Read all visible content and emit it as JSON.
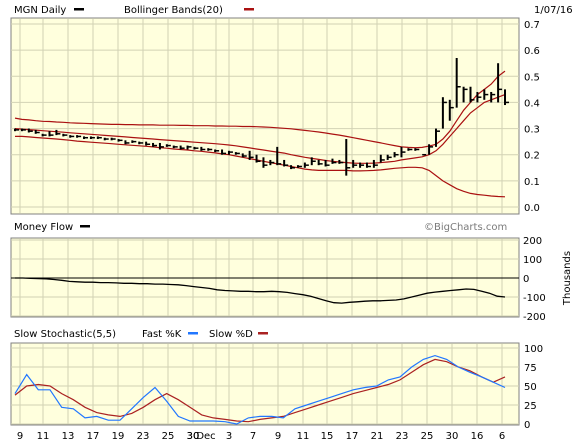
{
  "header": {
    "ticker_label": "MGN Daily",
    "bands_label": "Bollinger Bands(20)",
    "date": "1/07/16",
    "watermark": "©BigCharts.com"
  },
  "colors": {
    "panel_bg": "#ffffdd",
    "grid": "#d2d2b4",
    "price": "#000000",
    "bands": "#aa1111",
    "fastk": "#2277ff",
    "slowd": "#aa2222"
  },
  "chart_data": [
    {
      "type": "line",
      "name": "price",
      "ylim": [
        0,
        0.7
      ],
      "ytick_labels": [
        "0.7",
        "0.6",
        "0.5",
        "0.4",
        "0.3",
        "0.2",
        "0.1",
        "0.0"
      ],
      "bars": [
        {
          "h": 0.3,
          "l": 0.29,
          "c": 0.295
        },
        {
          "h": 0.3,
          "l": 0.29,
          "c": 0.295
        },
        {
          "h": 0.3,
          "l": 0.285,
          "c": 0.29
        },
        {
          "h": 0.295,
          "l": 0.28,
          "c": 0.285
        },
        {
          "h": 0.28,
          "l": 0.27,
          "c": 0.275
        },
        {
          "h": 0.29,
          "l": 0.27,
          "c": 0.275
        },
        {
          "h": 0.295,
          "l": 0.275,
          "c": 0.28
        },
        {
          "h": 0.28,
          "l": 0.27,
          "c": 0.275
        },
        {
          "h": 0.275,
          "l": 0.265,
          "c": 0.27
        },
        {
          "h": 0.275,
          "l": 0.265,
          "c": 0.27
        },
        {
          "h": 0.27,
          "l": 0.26,
          "c": 0.265
        },
        {
          "h": 0.27,
          "l": 0.26,
          "c": 0.265
        },
        {
          "h": 0.27,
          "l": 0.26,
          "c": 0.265
        },
        {
          "h": 0.265,
          "l": 0.255,
          "c": 0.26
        },
        {
          "h": 0.265,
          "l": 0.255,
          "c": 0.26
        },
        {
          "h": 0.26,
          "l": 0.25,
          "c": 0.255
        },
        {
          "h": 0.255,
          "l": 0.24,
          "c": 0.245
        },
        {
          "h": 0.255,
          "l": 0.245,
          "c": 0.25
        },
        {
          "h": 0.25,
          "l": 0.24,
          "c": 0.245
        },
        {
          "h": 0.25,
          "l": 0.235,
          "c": 0.24
        },
        {
          "h": 0.245,
          "l": 0.23,
          "c": 0.235
        },
        {
          "h": 0.245,
          "l": 0.22,
          "c": 0.23
        },
        {
          "h": 0.24,
          "l": 0.23,
          "c": 0.235
        },
        {
          "h": 0.235,
          "l": 0.225,
          "c": 0.23
        },
        {
          "h": 0.235,
          "l": 0.22,
          "c": 0.225
        },
        {
          "h": 0.235,
          "l": 0.22,
          "c": 0.23
        },
        {
          "h": 0.23,
          "l": 0.22,
          "c": 0.225
        },
        {
          "h": 0.23,
          "l": 0.215,
          "c": 0.22
        },
        {
          "h": 0.225,
          "l": 0.215,
          "c": 0.22
        },
        {
          "h": 0.22,
          "l": 0.21,
          "c": 0.215
        },
        {
          "h": 0.22,
          "l": 0.2,
          "c": 0.205
        },
        {
          "h": 0.215,
          "l": 0.2,
          "c": 0.21
        },
        {
          "h": 0.21,
          "l": 0.2,
          "c": 0.205
        },
        {
          "h": 0.205,
          "l": 0.19,
          "c": 0.195
        },
        {
          "h": 0.215,
          "l": 0.18,
          "c": 0.19
        },
        {
          "h": 0.2,
          "l": 0.17,
          "c": 0.175
        },
        {
          "h": 0.19,
          "l": 0.15,
          "c": 0.16
        },
        {
          "h": 0.18,
          "l": 0.16,
          "c": 0.17
        },
        {
          "h": 0.23,
          "l": 0.16,
          "c": 0.165
        },
        {
          "h": 0.18,
          "l": 0.155,
          "c": 0.16
        },
        {
          "h": 0.16,
          "l": 0.145,
          "c": 0.15
        },
        {
          "h": 0.16,
          "l": 0.15,
          "c": 0.155
        },
        {
          "h": 0.17,
          "l": 0.15,
          "c": 0.16
        },
        {
          "h": 0.19,
          "l": 0.16,
          "c": 0.175
        },
        {
          "h": 0.18,
          "l": 0.16,
          "c": 0.165
        },
        {
          "h": 0.18,
          "l": 0.155,
          "c": 0.16
        },
        {
          "h": 0.185,
          "l": 0.165,
          "c": 0.17
        },
        {
          "h": 0.18,
          "l": 0.165,
          "c": 0.17
        },
        {
          "h": 0.26,
          "l": 0.12,
          "c": 0.15
        },
        {
          "h": 0.18,
          "l": 0.15,
          "c": 0.16
        },
        {
          "h": 0.17,
          "l": 0.15,
          "c": 0.16
        },
        {
          "h": 0.17,
          "l": 0.15,
          "c": 0.155
        },
        {
          "h": 0.18,
          "l": 0.15,
          "c": 0.16
        },
        {
          "h": 0.2,
          "l": 0.17,
          "c": 0.18
        },
        {
          "h": 0.2,
          "l": 0.18,
          "c": 0.19
        },
        {
          "h": 0.21,
          "l": 0.19,
          "c": 0.2
        },
        {
          "h": 0.23,
          "l": 0.19,
          "c": 0.21
        },
        {
          "h": 0.225,
          "l": 0.215,
          "c": 0.22
        },
        {
          "h": 0.225,
          "l": 0.215,
          "c": 0.22
        },
        {
          "h": 0.2,
          "l": 0.2,
          "c": 0.2
        },
        {
          "h": 0.24,
          "l": 0.2,
          "c": 0.23
        },
        {
          "h": 0.3,
          "l": 0.23,
          "c": 0.29
        },
        {
          "h": 0.42,
          "l": 0.3,
          "c": 0.4
        },
        {
          "h": 0.41,
          "l": 0.33,
          "c": 0.38
        },
        {
          "h": 0.57,
          "l": 0.38,
          "c": 0.46
        },
        {
          "h": 0.46,
          "l": 0.4,
          "c": 0.45
        },
        {
          "h": 0.46,
          "l": 0.4,
          "c": 0.41
        },
        {
          "h": 0.44,
          "l": 0.4,
          "c": 0.42
        },
        {
          "h": 0.45,
          "l": 0.41,
          "c": 0.43
        },
        {
          "h": 0.44,
          "l": 0.4,
          "c": 0.43
        },
        {
          "h": 0.55,
          "l": 0.4,
          "c": 0.45
        },
        {
          "h": 0.45,
          "l": 0.39,
          "c": 0.4
        }
      ],
      "upper_band": [
        0.34,
        0.335,
        0.333,
        0.33,
        0.328,
        0.327,
        0.325,
        0.324,
        0.322,
        0.321,
        0.32,
        0.319,
        0.318,
        0.317,
        0.316,
        0.316,
        0.315,
        0.315,
        0.314,
        0.314,
        0.314,
        0.313,
        0.313,
        0.313,
        0.312,
        0.312,
        0.311,
        0.311,
        0.311,
        0.31,
        0.31,
        0.309,
        0.309,
        0.308,
        0.308,
        0.307,
        0.306,
        0.305,
        0.303,
        0.301,
        0.299,
        0.296,
        0.293,
        0.29,
        0.287,
        0.283,
        0.279,
        0.275,
        0.27,
        0.265,
        0.26,
        0.255,
        0.25,
        0.245,
        0.24,
        0.235,
        0.23,
        0.228,
        0.227,
        0.228,
        0.233,
        0.24,
        0.26,
        0.29,
        0.33,
        0.37,
        0.4,
        0.43,
        0.45,
        0.47,
        0.5,
        0.52
      ],
      "lower_band": [
        0.27,
        0.27,
        0.268,
        0.266,
        0.264,
        0.262,
        0.26,
        0.258,
        0.255,
        0.252,
        0.25,
        0.248,
        0.246,
        0.244,
        0.242,
        0.24,
        0.238,
        0.236,
        0.234,
        0.232,
        0.23,
        0.227,
        0.225,
        0.222,
        0.22,
        0.218,
        0.215,
        0.213,
        0.21,
        0.207,
        0.203,
        0.2,
        0.195,
        0.19,
        0.185,
        0.18,
        0.175,
        0.17,
        0.165,
        0.16,
        0.155,
        0.15,
        0.145,
        0.142,
        0.14,
        0.14,
        0.14,
        0.14,
        0.14,
        0.138,
        0.138,
        0.139,
        0.14,
        0.142,
        0.145,
        0.148,
        0.15,
        0.152,
        0.152,
        0.15,
        0.14,
        0.12,
        0.1,
        0.085,
        0.07,
        0.06,
        0.052,
        0.048,
        0.045,
        0.042,
        0.04,
        0.039
      ],
      "mid_band": [
        0.3,
        0.298,
        0.296,
        0.294,
        0.292,
        0.29,
        0.288,
        0.286,
        0.284,
        0.282,
        0.28,
        0.278,
        0.276,
        0.274,
        0.272,
        0.27,
        0.268,
        0.266,
        0.264,
        0.262,
        0.26,
        0.258,
        0.256,
        0.254,
        0.252,
        0.25,
        0.248,
        0.246,
        0.244,
        0.242,
        0.24,
        0.237,
        0.234,
        0.23,
        0.226,
        0.222,
        0.218,
        0.214,
        0.21,
        0.206,
        0.2,
        0.195,
        0.19,
        0.186,
        0.182,
        0.178,
        0.175,
        0.172,
        0.17,
        0.168,
        0.167,
        0.167,
        0.168,
        0.17,
        0.172,
        0.175,
        0.18,
        0.184,
        0.188,
        0.192,
        0.2,
        0.215,
        0.24,
        0.27,
        0.3,
        0.33,
        0.36,
        0.38,
        0.4,
        0.41,
        0.42,
        0.43
      ]
    },
    {
      "type": "area",
      "name": "money-flow",
      "title": "Money Flow",
      "units": "Thousands",
      "ylim": [
        -200,
        200
      ],
      "ytick_labels": [
        "200",
        "100",
        "0",
        "-100",
        "-200"
      ],
      "values": [
        0,
        0,
        -2,
        -3,
        -5,
        -8,
        -12,
        -18,
        -20,
        -22,
        -22,
        -24,
        -24,
        -26,
        -28,
        -28,
        -30,
        -30,
        -32,
        -32,
        -34,
        -36,
        -40,
        -45,
        -50,
        -55,
        -62,
        -66,
        -68,
        -70,
        -70,
        -72,
        -72,
        -70,
        -72,
        -76,
        -82,
        -88,
        -96,
        -108,
        -120,
        -130,
        -132,
        -128,
        -125,
        -122,
        -120,
        -120,
        -118,
        -116,
        -110,
        -100,
        -90,
        -80,
        -74,
        -70,
        -66,
        -62,
        -58,
        -60,
        -70,
        -80,
        -96,
        -100
      ]
    },
    {
      "type": "line",
      "name": "slow-stochastic",
      "title": "Slow Stochastic(5,5)",
      "ylim": [
        0,
        100
      ],
      "ytick_labels": [
        "100",
        "75",
        "50",
        "25",
        "0"
      ],
      "legend": [
        "Fast %K",
        "Slow %D"
      ],
      "x_tick_labels": [
        "9",
        "11",
        "13",
        "17",
        "19",
        "23",
        "25",
        "30",
        "Dec",
        "3",
        "7",
        "9",
        "11",
        "15",
        "17",
        "21",
        "23",
        "25",
        "30",
        "16",
        "6"
      ],
      "fastk": [
        40,
        65,
        45,
        45,
        22,
        20,
        8,
        10,
        5,
        5,
        20,
        35,
        48,
        30,
        10,
        4,
        4,
        4,
        3,
        0,
        8,
        10,
        10,
        8,
        20,
        25,
        30,
        35,
        40,
        45,
        48,
        50,
        58,
        62,
        75,
        85,
        90,
        85,
        75,
        68,
        62,
        55,
        48
      ],
      "slowd": [
        38,
        50,
        52,
        50,
        40,
        32,
        22,
        15,
        12,
        10,
        14,
        22,
        32,
        40,
        32,
        22,
        12,
        8,
        6,
        4,
        3,
        6,
        8,
        10,
        15,
        20,
        25,
        30,
        35,
        40,
        44,
        48,
        52,
        58,
        68,
        78,
        85,
        82,
        75,
        70,
        62,
        55,
        62
      ]
    }
  ]
}
